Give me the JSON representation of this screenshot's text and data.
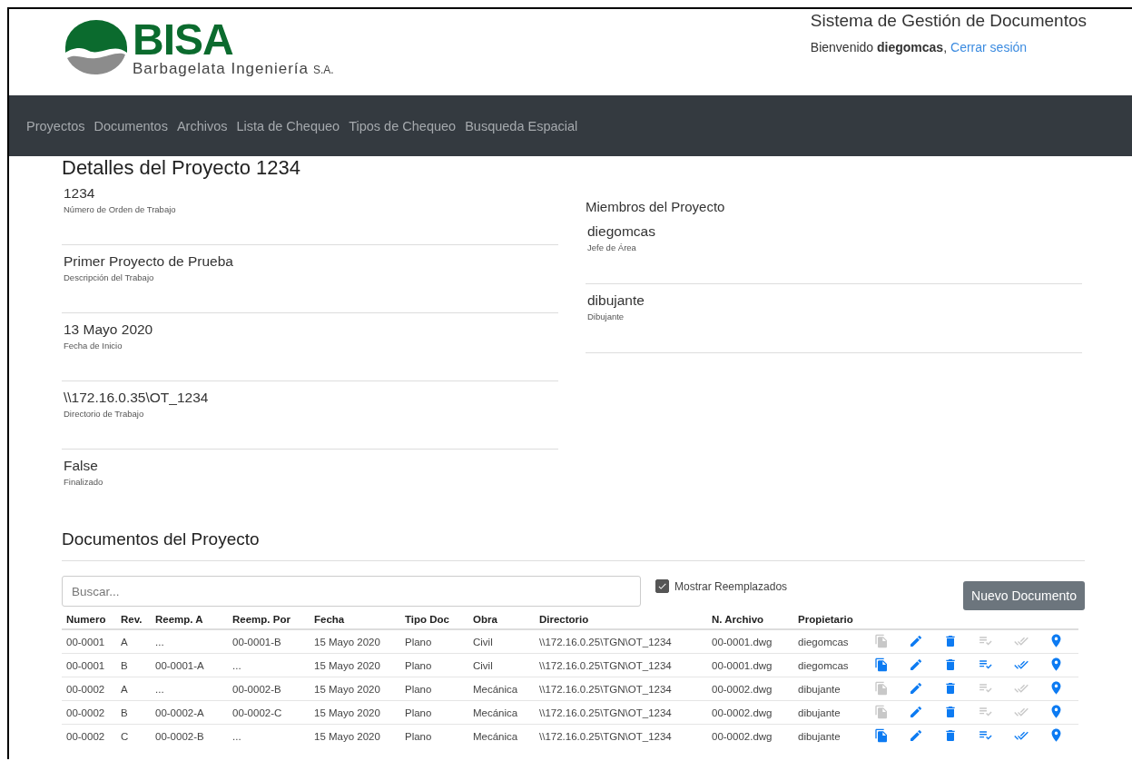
{
  "header": {
    "brand": "BISA",
    "brand_subtitle": "Barbagelata Ingeniería",
    "brand_suffix": "S.A.",
    "app_title": "Sistema de Gestión de Documentos",
    "greeting": "Bienvenido **diegomcas**,",
    "logout_link": "Cerrar sesión"
  },
  "nav": {
    "items": [
      {
        "label": "Proyectos"
      },
      {
        "label": "Documentos"
      },
      {
        "label": "Archivos"
      },
      {
        "label": "Lista de Chequeo"
      },
      {
        "label": "Tipos de Chequeo"
      },
      {
        "label": "Busqueda Espacial"
      }
    ]
  },
  "project": {
    "title": "Detalles del Proyecto 1234",
    "fields": [
      {
        "value": "1234",
        "label": "Número de Orden de Trabajo"
      },
      {
        "value": "Primer Proyecto de Prueba",
        "label": "Descripción del Trabajo"
      },
      {
        "value": "13 Mayo 2020",
        "label": "Fecha de Inicio"
      },
      {
        "value": "\\\\172.16.0.35\\OT_1234",
        "label": "Directorio de Trabajo"
      },
      {
        "value": "False",
        "label": "Finalizado"
      }
    ],
    "members_title": "Miembros del Proyecto",
    "members": [
      {
        "name": "diegomcas",
        "role": "Jefe de Área"
      },
      {
        "name": "dibujante",
        "role": "Dibujante"
      }
    ]
  },
  "documents": {
    "title": "Documentos del Proyecto",
    "search": {
      "placeholder": "Buscar..."
    },
    "show_replaced": {
      "label": "Mostrar Reemplazados",
      "checked": true
    },
    "new_button": "Nuevo Documento",
    "columns": [
      "Numero",
      "Rev.",
      "Reemp. A",
      "Reemp. Por",
      "Fecha",
      "Tipo Doc",
      "Obra",
      "Directorio",
      "N. Archivo",
      "Propietario"
    ],
    "rows": [
      {
        "cells": [
          "00-0001",
          "A",
          "...",
          "00-0001-B",
          "15 Mayo 2020",
          "Plano",
          "Civil",
          "\\\\172.16.0.25\\TGN\\OT_1234",
          "00-0001.dwg",
          "diegomcas"
        ],
        "copy_enabled": false,
        "checklist_enabled": false,
        "approve_enabled": false
      },
      {
        "cells": [
          "00-0001",
          "B",
          "00-0001-A",
          "...",
          "15 Mayo 2020",
          "Plano",
          "Civil",
          "\\\\172.16.0.25\\TGN\\OT_1234",
          "00-0001.dwg",
          "diegomcas"
        ],
        "copy_enabled": true,
        "checklist_enabled": true,
        "approve_enabled": true
      },
      {
        "cells": [
          "00-0002",
          "A",
          "...",
          "00-0002-B",
          "15 Mayo 2020",
          "Plano",
          "Mecánica",
          "\\\\172.16.0.25\\TGN\\OT_1234",
          "00-0002.dwg",
          "dibujante"
        ],
        "copy_enabled": false,
        "checklist_enabled": false,
        "approve_enabled": false
      },
      {
        "cells": [
          "00-0002",
          "B",
          "00-0002-A",
          "00-0002-C",
          "15 Mayo 2020",
          "Plano",
          "Mecánica",
          "\\\\172.16.0.25\\TGN\\OT_1234",
          "00-0002.dwg",
          "dibujante"
        ],
        "copy_enabled": false,
        "checklist_enabled": false,
        "approve_enabled": false
      },
      {
        "cells": [
          "00-0002",
          "C",
          "00-0002-B",
          "...",
          "15 Mayo 2020",
          "Plano",
          "Mecánica",
          "\\\\172.16.0.25\\TGN\\OT_1234",
          "00-0002.dwg",
          "dibujante"
        ],
        "copy_enabled": true,
        "checklist_enabled": true,
        "approve_enabled": true
      }
    ]
  }
}
